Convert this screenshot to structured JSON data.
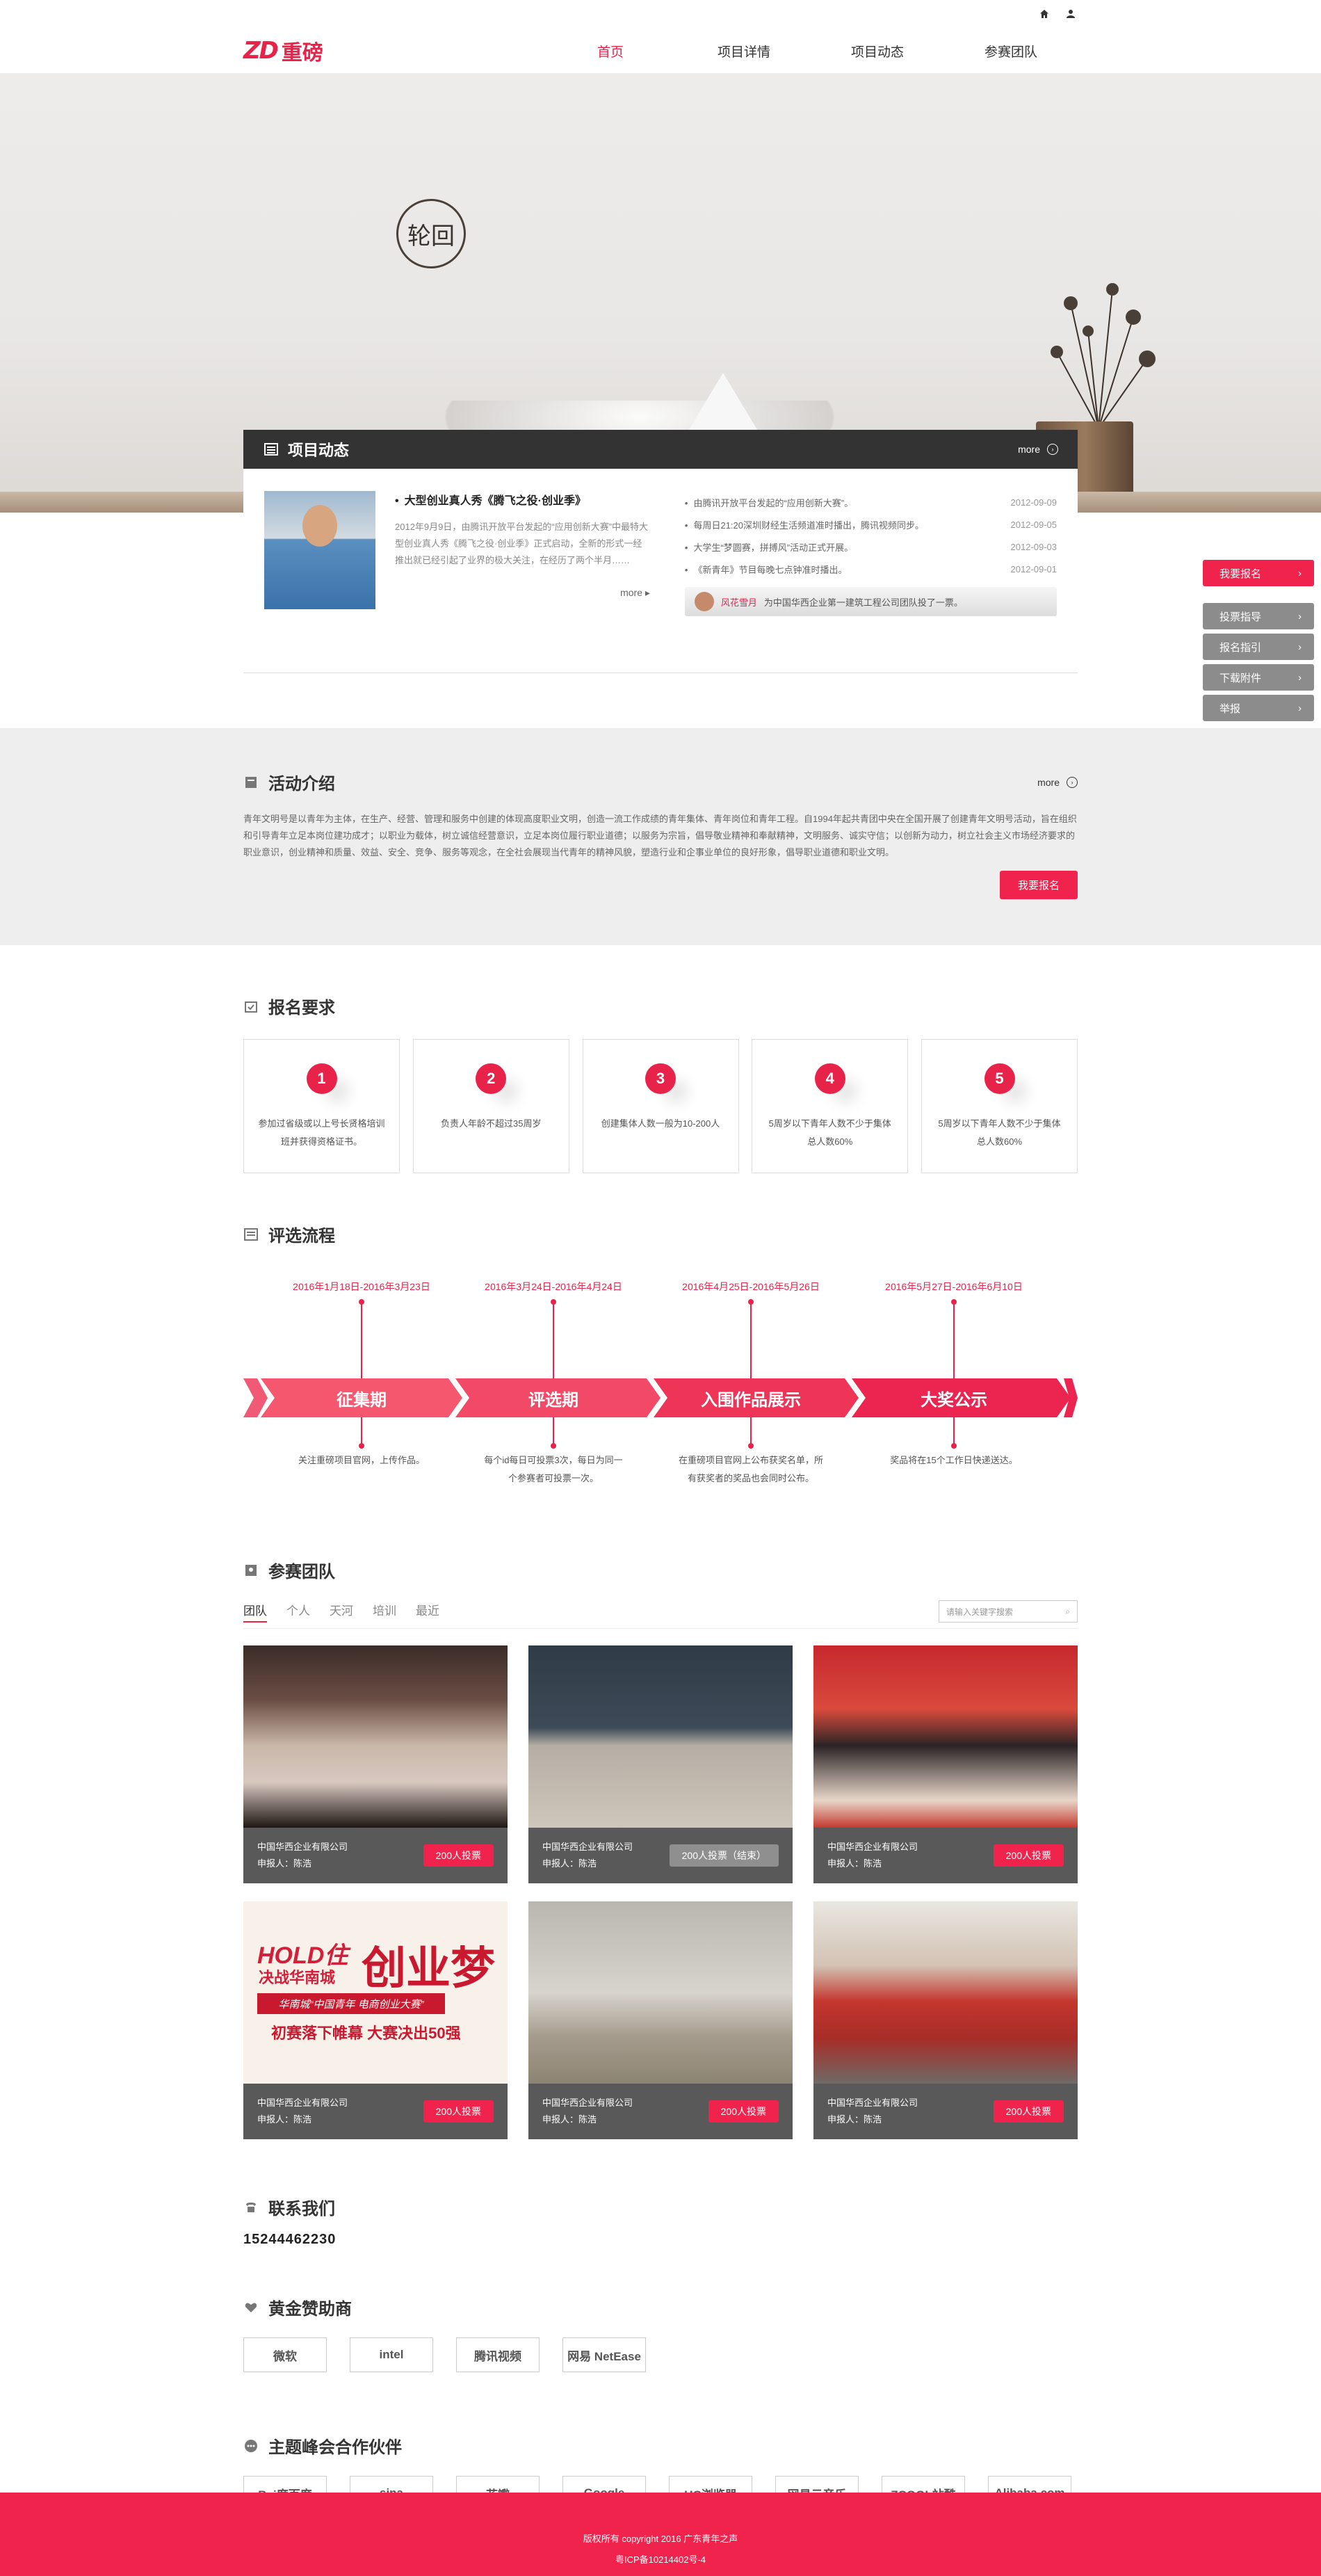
{
  "header": {
    "logo_mark": "ZD",
    "logo_text": "重磅",
    "nav": [
      "首页",
      "项目详情",
      "项目动态",
      "参赛团队"
    ]
  },
  "hero": {
    "seal_text": "轮回"
  },
  "news": {
    "title": "项目动态",
    "more": "more",
    "feature": {
      "title": "大型创业真人秀《腾飞之役·创业季》",
      "body": "2012年9月9日，由腾讯开放平台发起的“应用创新大赛”中最特大型创业真人秀《腾飞之役·创业季》正式启动，全新的形式一经推出就已经引起了业界的极大关注，在经历了两个半月……",
      "more": "more"
    },
    "list": [
      {
        "t": "由腾讯开放平台发起的“应用创新大赛”。",
        "d": "2012-09-09"
      },
      {
        "t": "每周日21:20深圳财经生活频道准时播出，腾讯视频同步。",
        "d": "2012-09-05"
      },
      {
        "t": "大学生“梦圆赛，拼搏风”活动正式开展。",
        "d": "2012-09-03"
      },
      {
        "t": "《新青年》节目每晚七点钟准时播出。",
        "d": "2012-09-01"
      }
    ],
    "comment": {
      "name": "风花雪月",
      "text": "为中国华西企业第一建筑工程公司团队投了一票。"
    }
  },
  "side_menu": [
    "我要报名",
    "投票指导",
    "报名指引",
    "下载附件",
    "举报"
  ],
  "activity": {
    "title": "活动介绍",
    "more": "more",
    "body": "青年文明号是以青年为主体，在生产、经营、管理和服务中创建的体现高度职业文明，创造一流工作成绩的青年集体、青年岗位和青年工程。自1994年起共青团中央在全国开展了创建青年文明号活动，旨在组织和引导青年立足本岗位建功成才；以职业为载体，树立诚信经营意识，立足本岗位履行职业道德；以服务为宗旨，倡导敬业精神和奉献精神，文明服务、诚实守信；以创新为动力，树立社会主义市场经济要求的职业意识，创业精神和质量、效益、安全、竞争、服务等观念，在全社会展现当代青年的精神风貌，塑造行业和企事业单位的良好形象，倡导职业道德和职业文明。",
    "button": "我要报名"
  },
  "requirements": {
    "title": "报名要求",
    "items": [
      {
        "n": "1",
        "text": "参加过省级或以上号长贤格培训班并获得资格证书。"
      },
      {
        "n": "2",
        "text": "负责人年龄不超过35周岁"
      },
      {
        "n": "3",
        "text": "创建集体人数一般为10-200人"
      },
      {
        "n": "4",
        "text": "5周岁以下青年人数不少于集体总人数60%"
      },
      {
        "n": "5",
        "text": "5周岁以下青年人数不少于集体总人数60%"
      }
    ]
  },
  "process": {
    "title": "评选流程",
    "steps": [
      {
        "name": "征集期",
        "date": "2016年1月18日-2016年3月23日",
        "desc": "关注重磅项目官网，上传作品。"
      },
      {
        "name": "评选期",
        "date": "2016年3月24日-2016年4月24日",
        "desc": "每个id每日可投票3次，每日为同一个参赛者可投票一次。"
      },
      {
        "name": "入围作品展示",
        "date": "2016年4月25日-2016年5月26日",
        "desc": "在重磅项目官网上公布获奖名单，所有获奖者的奖品也会同时公布。"
      },
      {
        "name": "大奖公示",
        "date": "2016年5月27日-2016年6月10日",
        "desc": "奖品将在15个工作日快递送达。"
      }
    ]
  },
  "teams": {
    "title": "参赛团队",
    "tabs": [
      "团队",
      "个人",
      "天河",
      "培训",
      "最近"
    ],
    "search_placeholder": "请输入关键字搜索",
    "cards": [
      {
        "company": "中国华西企业有限公司",
        "reporter": "申报人：陈浩",
        "vote": "200人投票",
        "voted": false
      },
      {
        "company": "中国华西企业有限公司",
        "reporter": "申报人：陈浩",
        "vote": "200人投票（结束）",
        "voted": true
      },
      {
        "company": "中国华西企业有限公司",
        "reporter": "申报人：陈浩",
        "vote": "200人投票",
        "voted": false
      },
      {
        "company": "中国华西企业有限公司",
        "reporter": "申报人：陈浩",
        "vote": "200人投票",
        "voted": false
      },
      {
        "company": "中国华西企业有限公司",
        "reporter": "申报人：陈浩",
        "vote": "200人投票",
        "voted": false
      },
      {
        "company": "中国华西企业有限公司",
        "reporter": "申报人：陈浩",
        "vote": "200人投票",
        "voted": false
      }
    ],
    "poster": {
      "line1": "HOLD住",
      "line2": "决战华南城",
      "line3": "创业梦",
      "line4": "华南城“中国青年 电商创业大赛”",
      "line5": "初赛落下帷幕 大赛决出50强"
    }
  },
  "contact": {
    "title": "联系我们",
    "phone": "15244462230"
  },
  "sponsors": {
    "title": "黄金赞助商",
    "logos": [
      "微软",
      "intel",
      "腾讯视频",
      "网易 NetEase"
    ]
  },
  "partners": {
    "title": "主题峰会合作伙伴",
    "logos": [
      "Bai度百度",
      "sina",
      "花瓣",
      "Google",
      "UC浏览器",
      "网易云音乐",
      "ZCOOL站酷",
      "Alibaba.com"
    ]
  },
  "footer": {
    "line1": "版权所有 copyright 2016 广东青年之声",
    "line2": "粤ICP备10214402号-4"
  },
  "colors": {
    "accent": "#f0234d",
    "dark": "#333333",
    "gray": "#595959"
  }
}
